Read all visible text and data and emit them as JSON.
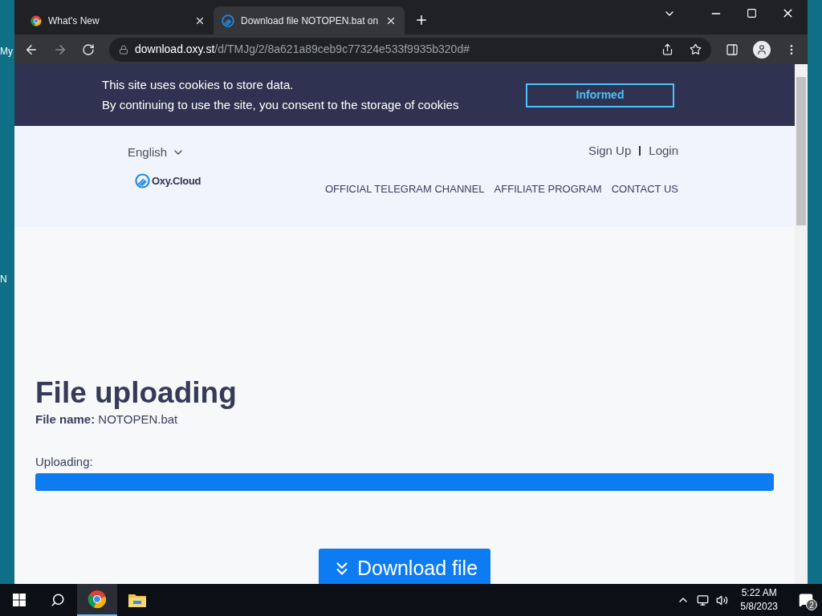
{
  "desktop": {
    "icon_labels": [
      "My",
      "N"
    ]
  },
  "browser": {
    "tabs": [
      {
        "title": "What's New",
        "selected": false
      },
      {
        "title": "Download file NOTOPEN.bat on",
        "selected": true
      }
    ],
    "url": {
      "host": "download.oxy.st",
      "path": "/d/TMJg/2/8a621a89ceb9c77324e533f9935b320d#"
    }
  },
  "page": {
    "cookie_banner": {
      "lines": [
        "This site uses cookies to store data.",
        "By continuing to use the site, you consent to the storage of cookies"
      ],
      "button": "Informed"
    },
    "language": "English",
    "auth_links": [
      "Sign Up",
      "Login"
    ],
    "logo": "Oxy.Cloud",
    "nav": [
      "OFFICIAL TELEGRAM CHANNEL",
      "AFFILIATE PROGRAM",
      "CONTACT US"
    ],
    "title": "File uploading",
    "file_name": {
      "label": "File name:",
      "value": "NOTOPEN.bat"
    },
    "progress": {
      "label": "Uploading:",
      "level": 1
    },
    "download_button": "Download file"
  },
  "taskbar": {
    "time": "5:22 AM",
    "date": "5/8/2023",
    "notification_count": "2"
  }
}
